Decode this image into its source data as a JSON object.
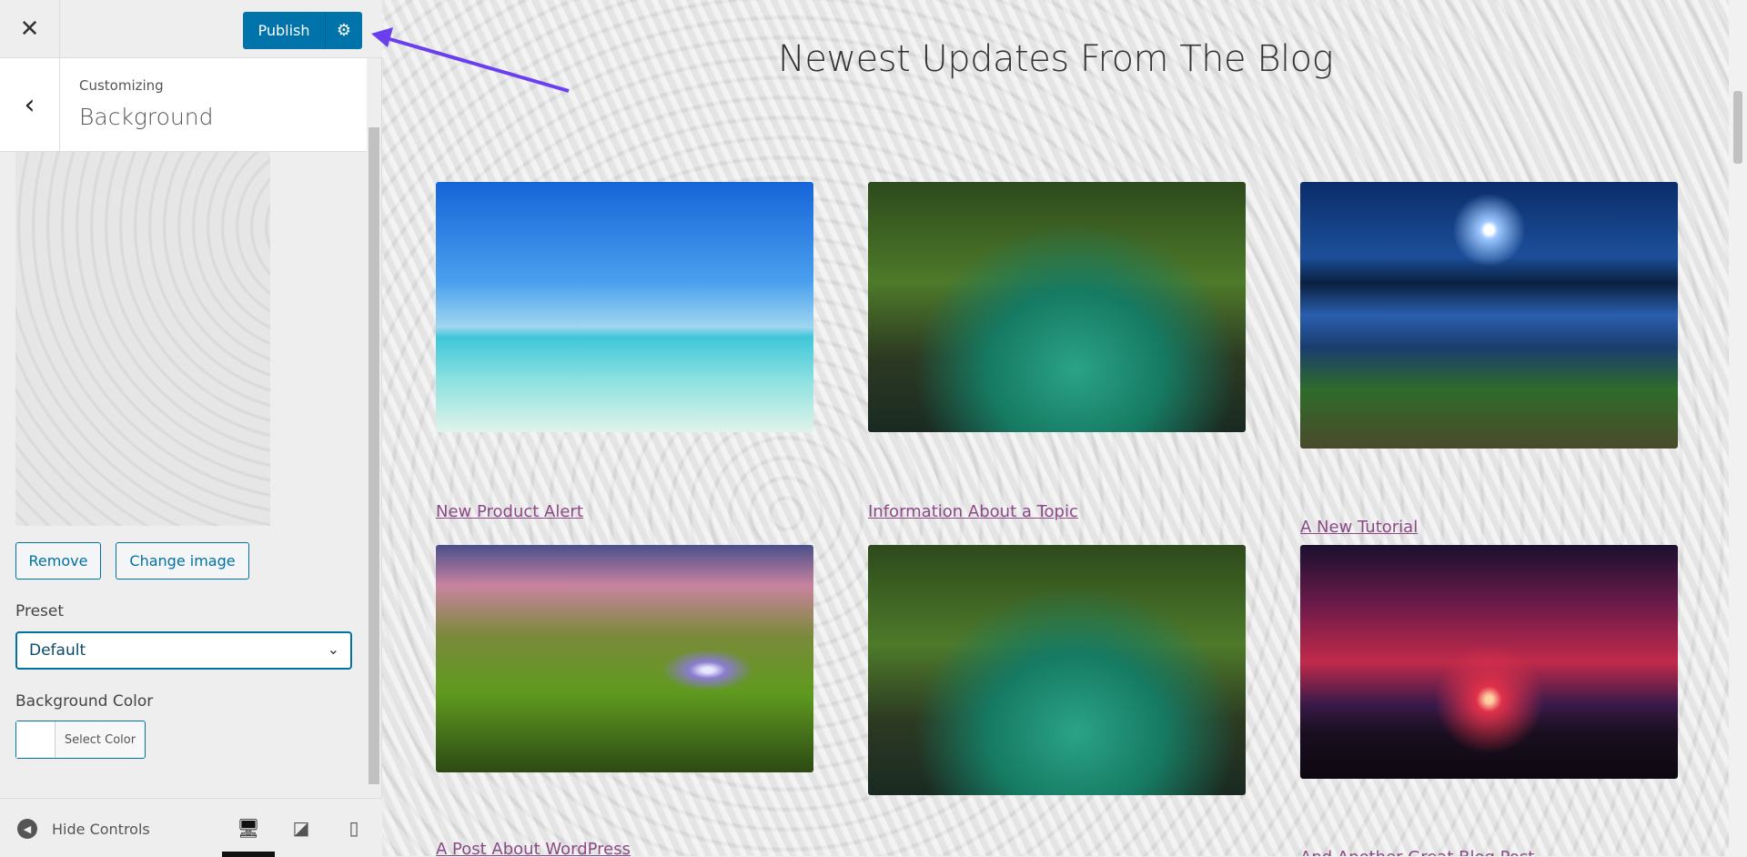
{
  "sidebar": {
    "close_label": "✕",
    "publish_label": "Publish",
    "panel": {
      "breadcrumb": "Customizing",
      "title": "Background"
    },
    "remove_label": "Remove",
    "change_image_label": "Change image",
    "preset_label": "Preset",
    "preset_value": "Default",
    "background_color_label": "Background Color",
    "select_color_label": "Select Color",
    "hide_controls_label": "Hide Controls",
    "selected_device": "desktop"
  },
  "main": {
    "title": "Newest Updates From The Blog",
    "posts": [
      {
        "title": "New Product Alert",
        "image": "tropical beach"
      },
      {
        "title": "Information About a Topic",
        "image": "forest river"
      },
      {
        "title": "A New Tutorial",
        "image": "lake pier at night"
      },
      {
        "title": "A Post About WordPress",
        "image": "waterfall"
      },
      {
        "title": "",
        "image": "forest river"
      },
      {
        "title": "And Another Great Blog Post",
        "image": "tree at red sunset"
      }
    ]
  },
  "colors": {
    "accent": "#0073aa",
    "link": "#8b4a86",
    "annotation_arrow": "#6a3ff0"
  }
}
